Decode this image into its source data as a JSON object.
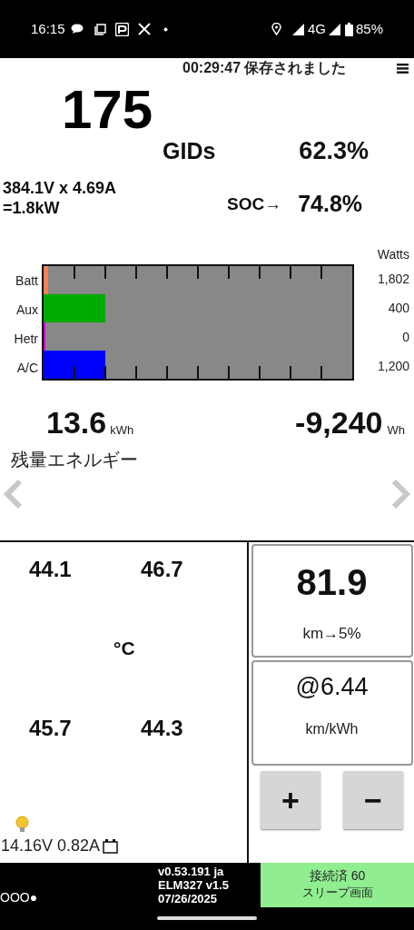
{
  "status_bar": {
    "time": "16:15",
    "network": "4G",
    "battery": "85%"
  },
  "header": {
    "saved": "00:29:47 保存されました"
  },
  "gids": {
    "value": "175",
    "unit": "GIDs",
    "percent": "62.3%"
  },
  "power": {
    "line1": "384.1V x 4.69A",
    "line2": "=1.8kW",
    "soc_label": "SOC→",
    "soc": "74.8%"
  },
  "meters": {
    "unit": "Watts",
    "rows": [
      {
        "label": "Batt",
        "level": 0.015,
        "color": "#ff7f50",
        "reading": "1,802"
      },
      {
        "label": "Aux",
        "level": 0.2,
        "color": "#00aa00",
        "reading": "400"
      },
      {
        "label": "Hetr",
        "level": 0.006,
        "color": "#cc00cc",
        "reading": "0"
      },
      {
        "label": "A/C",
        "level": 0.2,
        "color": "#0000ff",
        "reading": "1,200"
      }
    ]
  },
  "energy": {
    "remaining": "13.6",
    "remaining_unit": "kWh",
    "label": "残量エネルギー",
    "delta": "-9,240",
    "delta_unit": "Wh"
  },
  "temperatures": {
    "values": [
      "44.1",
      "46.7",
      "45.7",
      "44.3"
    ],
    "unit": "°C"
  },
  "range": {
    "value": "81.9",
    "label": "km→5%"
  },
  "efficiency": {
    "value": "@6.44",
    "label": "km/kWh"
  },
  "buttons": [
    "+",
    "−"
  ],
  "aux_battery": "14.16V 0.82A",
  "footer": {
    "dots": "OOO●",
    "version": [
      "v0.53.191 ja",
      "ELM327 v1.5",
      "07/26/2025"
    ],
    "connection": [
      "接続済 60",
      "スリープ画面"
    ]
  }
}
